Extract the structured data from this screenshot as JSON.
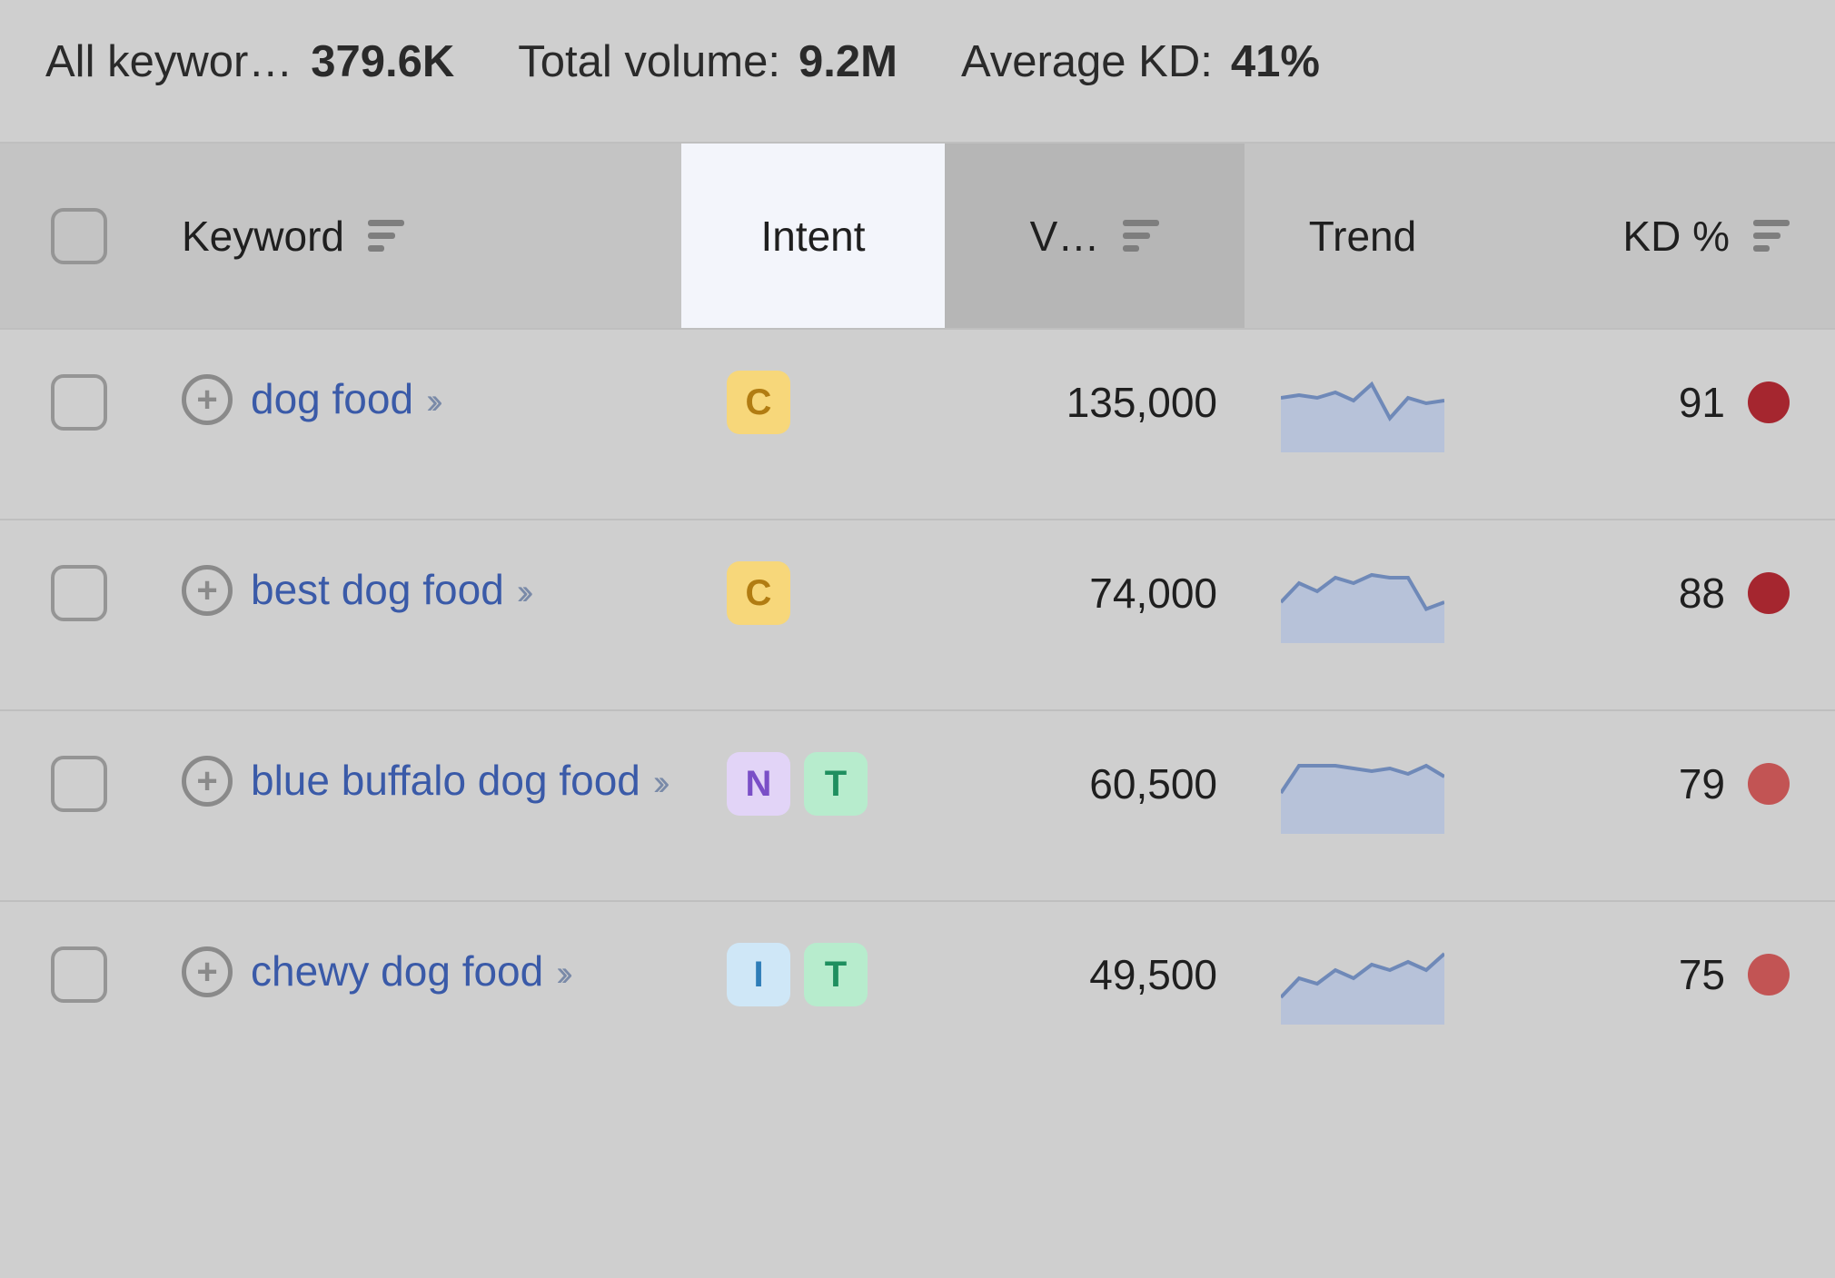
{
  "summary": {
    "keywords_label": "All keywor…",
    "keywords_value": "379.6K",
    "volume_label": "Total volume:",
    "volume_value": "9.2M",
    "kd_label": "Average KD:",
    "kd_value": "41%"
  },
  "columns": {
    "keyword": "Keyword",
    "intent": "Intent",
    "volume": "V…",
    "trend": "Trend",
    "kd": "KD %"
  },
  "intent_colors": {
    "C": {
      "bg": "#f7d77a",
      "fg": "#b17c12"
    },
    "N": {
      "bg": "#e2d4f7",
      "fg": "#7a4fc7"
    },
    "T": {
      "bg": "#b7eccd",
      "fg": "#1f8f5f"
    },
    "I": {
      "bg": "#cfe7f7",
      "fg": "#2e7db8"
    }
  },
  "kd_color_dark": "#a5262f",
  "kd_color_mid": "#c25454",
  "rows": [
    {
      "keyword": "dog food",
      "intents": [
        "C"
      ],
      "volume": "135,000",
      "trend": [
        40,
        42,
        40,
        44,
        38,
        50,
        25,
        40,
        36,
        38
      ],
      "kd": "91",
      "kd_dot": "dark"
    },
    {
      "keyword": "best dog food",
      "intents": [
        "C"
      ],
      "volume": "74,000",
      "trend": [
        30,
        44,
        38,
        48,
        44,
        50,
        48,
        48,
        25,
        30
      ],
      "kd": "88",
      "kd_dot": "dark"
    },
    {
      "keyword": "blue buffalo dog food",
      "intents": [
        "N",
        "T"
      ],
      "volume": "60,500",
      "trend": [
        30,
        50,
        50,
        50,
        48,
        46,
        48,
        44,
        50,
        42
      ],
      "kd": "79",
      "kd_dot": "mid"
    },
    {
      "keyword": "chewy dog food",
      "intents": [
        "I",
        "T"
      ],
      "volume": "49,500",
      "trend": [
        20,
        34,
        30,
        40,
        34,
        44,
        40,
        46,
        40,
        52
      ],
      "kd": "75",
      "kd_dot": "mid"
    }
  ]
}
